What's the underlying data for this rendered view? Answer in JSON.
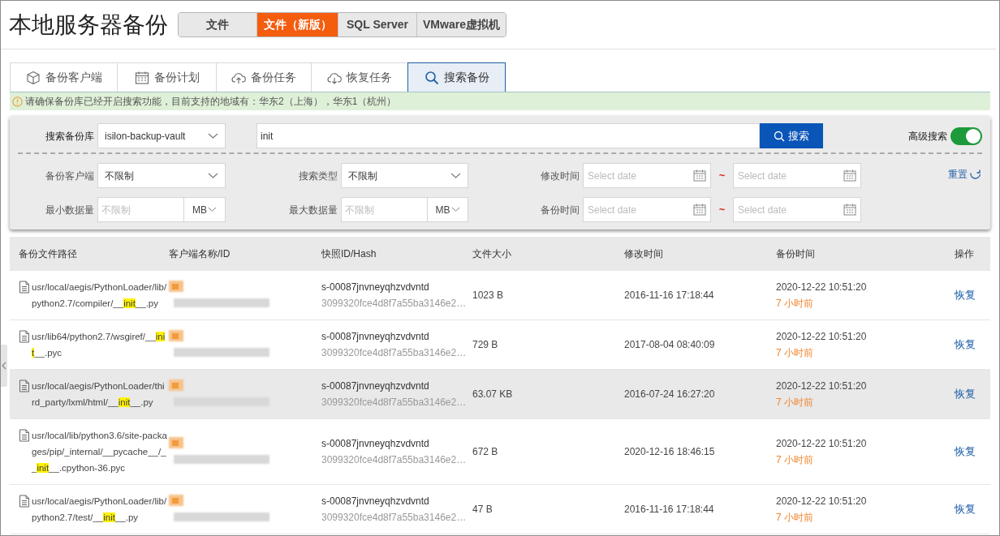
{
  "page_title": "本地服务器备份",
  "segments": [
    {
      "label": "文件",
      "selected": false
    },
    {
      "label": "文件（新版）",
      "selected": true
    },
    {
      "label": "SQL Server",
      "selected": false
    },
    {
      "label": "VMware虚拟机",
      "selected": false
    }
  ],
  "tabs": [
    {
      "label": "备份客户端",
      "selected": false
    },
    {
      "label": "备份计划",
      "selected": false
    },
    {
      "label": "备份任务",
      "selected": false
    },
    {
      "label": "恢复任务",
      "selected": false
    },
    {
      "label": "搜索备份",
      "selected": true
    }
  ],
  "notice": "请确保备份库已经开启搜索功能，目前支持的地域有：华东2（上海），华东1（杭州）",
  "filters": {
    "vault": {
      "label": "搜索备份库",
      "value": "isilon-backup-vault"
    },
    "keyword": {
      "value": "init"
    },
    "search_button": "搜索",
    "advanced": {
      "label": "高级搜索",
      "on": true
    },
    "reset": "重置",
    "rows": [
      [
        {
          "kind": "select",
          "label": "备份客户端",
          "value": "不限制"
        },
        {
          "kind": "select",
          "label": "搜索类型",
          "value": "不限制"
        },
        {
          "kind": "date_range",
          "label": "修改时间",
          "from_placeholder": "Select date",
          "separator": "~",
          "to_placeholder": "Select date"
        }
      ],
      [
        {
          "kind": "number_unit",
          "label": "最小数据量",
          "placeholder": "不限制",
          "unit": "MB"
        },
        {
          "kind": "number_unit",
          "label": "最大数据量",
          "placeholder": "不限制",
          "unit": "MB"
        },
        {
          "kind": "date_range",
          "label": "备份时间",
          "from_placeholder": "Select date",
          "separator": "~",
          "to_placeholder": "Select date"
        }
      ]
    ]
  },
  "table": {
    "columns": [
      "备份文件路径",
      "客户端名称/ID",
      "快照ID/Hash",
      "文件大小",
      "修改时间",
      "备份时间",
      "操作"
    ],
    "rows": [
      {
        "path_before": "usr/local/aegis/PythonLoader/lib/python2.7/compiler/__",
        "match": "init",
        "path_after": "__.py",
        "snapshot_id": "s-00087jnvneyqhzvdvntd",
        "hash": "3099320fce4d8f7a55ba3146e2…",
        "size": "1023 B",
        "modified": "2016-11-16 17:18:44",
        "backup_time": "2020-12-22 10:51:20",
        "backup_ago": "7 小时前",
        "action": "恢复",
        "highlighted": false
      },
      {
        "path_before": "usr/lib64/python2.7/wsgiref/__",
        "match": "init",
        "path_after": "__.pyc",
        "snapshot_id": "s-00087jnvneyqhzvdvntd",
        "hash": "3099320fce4d8f7a55ba3146e2…",
        "size": "729 B",
        "modified": "2017-08-04 08:40:09",
        "backup_time": "2020-12-22 10:51:20",
        "backup_ago": "7 小时前",
        "action": "恢复",
        "highlighted": false
      },
      {
        "path_before": "usr/local/aegis/PythonLoader/third_party/lxml/html/__",
        "match": "init",
        "path_after": "__.py",
        "snapshot_id": "s-00087jnvneyqhzvdvntd",
        "hash": "3099320fce4d8f7a55ba3146e2…",
        "size": "63.07 KB",
        "modified": "2016-07-24 16:27:20",
        "backup_time": "2020-12-22 10:51:20",
        "backup_ago": "7 小时前",
        "action": "恢复",
        "highlighted": true
      },
      {
        "path_before": "usr/local/lib/python3.6/site-packages/pip/_internal/__pycache__/__",
        "match": "init",
        "path_after": "__.cpython-36.pyc",
        "snapshot_id": "s-00087jnvneyqhzvdvntd",
        "hash": "3099320fce4d8f7a55ba3146e2…",
        "size": "672 B",
        "modified": "2020-12-16 18:46:15",
        "backup_time": "2020-12-22 10:51:20",
        "backup_ago": "7 小时前",
        "action": "恢复",
        "highlighted": false
      },
      {
        "path_before": "usr/local/aegis/PythonLoader/lib/python2.7/test/__",
        "match": "init",
        "path_after": "__.py",
        "snapshot_id": "s-00087jnvneyqhzvdvntd",
        "hash": "3099320fce4d8f7a55ba3146e2…",
        "size": "47 B",
        "modified": "2016-11-16 17:18:44",
        "backup_time": "2020-12-22 10:51:20",
        "backup_ago": "7 小时前",
        "action": "恢复",
        "highlighted": false
      }
    ]
  }
}
